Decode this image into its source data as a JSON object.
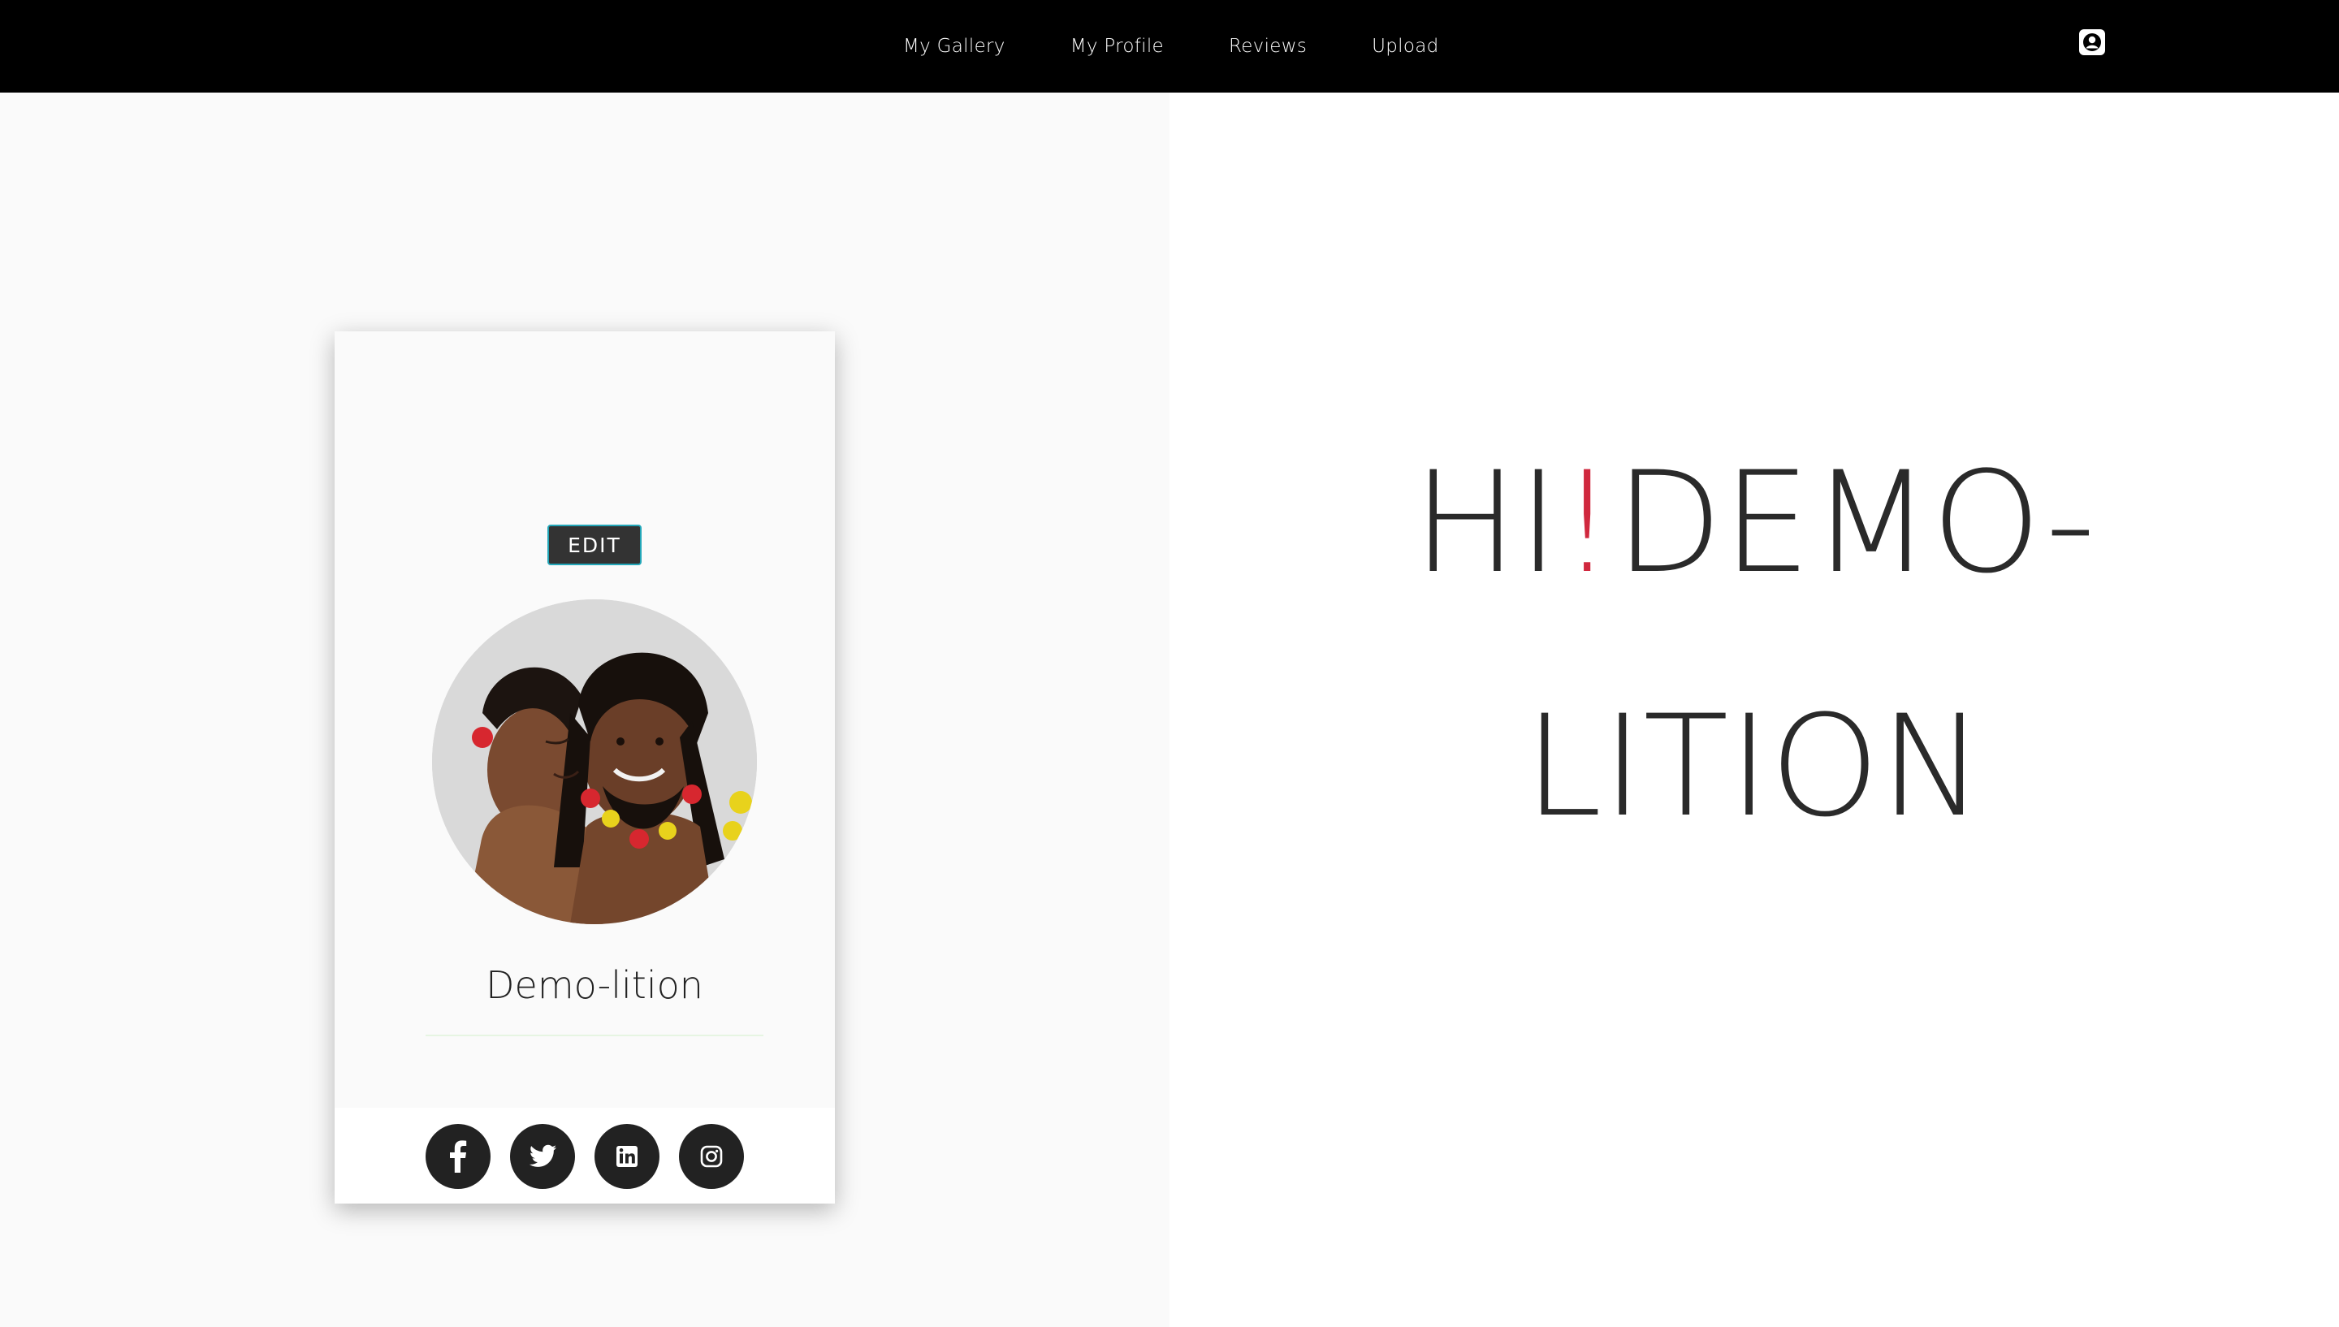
{
  "nav": {
    "links": [
      "My Gallery",
      "My Profile",
      "Reviews",
      "Upload"
    ],
    "account_icon": "user-circle-icon"
  },
  "profile": {
    "edit_label": "EDIT",
    "name": "Demo-lition",
    "avatar_description": "profile photo",
    "social": [
      {
        "icon": "facebook-icon"
      },
      {
        "icon": "twitter-icon"
      },
      {
        "icon": "linkedin-icon"
      },
      {
        "icon": "instagram-icon"
      }
    ]
  },
  "greeting": {
    "prefix": "HI",
    "exclaim": "!",
    "line1_rest": "DEMO-",
    "line2": "LITION"
  },
  "colors": {
    "nav_bg": "#000000",
    "accent_exclaim": "#d0283e",
    "edit_border": "#22a6b8",
    "icon_button": "#222222"
  }
}
